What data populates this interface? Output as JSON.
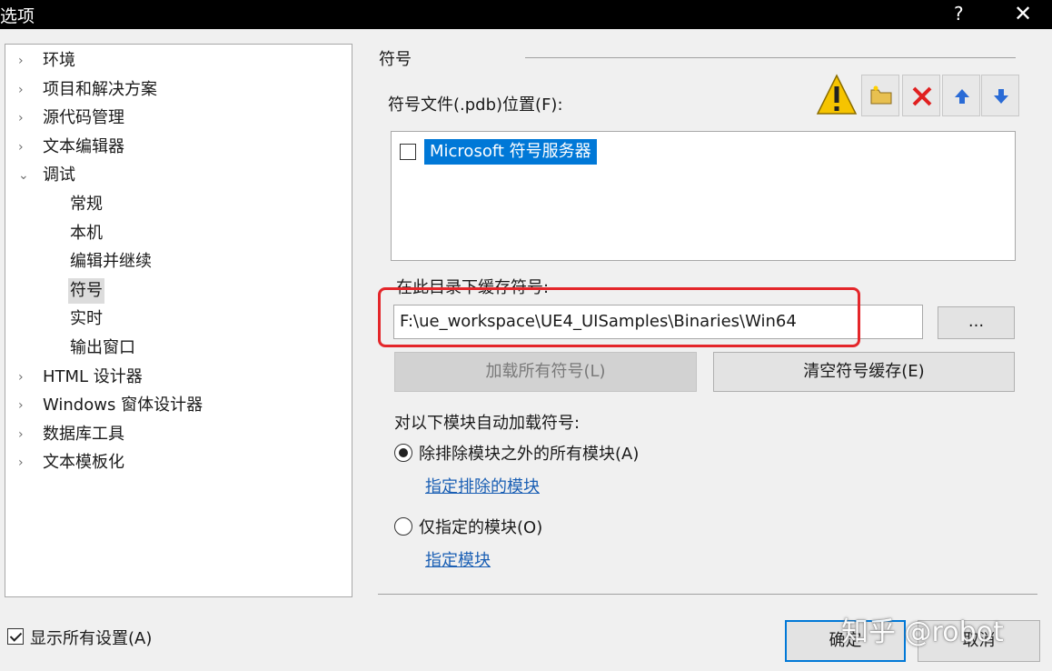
{
  "window": {
    "title": "选项",
    "help_label": "?",
    "close_label": "✕"
  },
  "tree": {
    "items": [
      {
        "label": "环境",
        "arrow": "›",
        "level": 0
      },
      {
        "label": "项目和解决方案",
        "arrow": "›",
        "level": 0
      },
      {
        "label": "源代码管理",
        "arrow": "›",
        "level": 0
      },
      {
        "label": "文本编辑器",
        "arrow": "›",
        "level": 0
      },
      {
        "label": "调试",
        "arrow": "⌄",
        "level": 0
      },
      {
        "label": "常规",
        "arrow": "",
        "level": 1
      },
      {
        "label": "本机",
        "arrow": "",
        "level": 1
      },
      {
        "label": "编辑并继续",
        "arrow": "",
        "level": 1
      },
      {
        "label": "符号",
        "arrow": "",
        "level": 1,
        "selected": true
      },
      {
        "label": "实时",
        "arrow": "",
        "level": 1
      },
      {
        "label": "输出窗口",
        "arrow": "",
        "level": 1
      },
      {
        "label": "HTML 设计器",
        "arrow": "›",
        "level": 0
      },
      {
        "label": "Windows 窗体设计器",
        "arrow": "›",
        "level": 0
      },
      {
        "label": "数据库工具",
        "arrow": "›",
        "level": 0
      },
      {
        "label": "文本模板化",
        "arrow": "›",
        "level": 0
      }
    ]
  },
  "show_all": {
    "label": "显示所有设置(A)",
    "checked": true
  },
  "symbols": {
    "section_title": "符号",
    "pdb_label": "符号文件(.pdb)位置(F):",
    "toolbar_icons": [
      "warning-icon",
      "folder-icon",
      "delete-icon",
      "move-up-icon",
      "move-down-icon"
    ],
    "pdb_locations": [
      {
        "label": "Microsoft 符号服务器",
        "checked": false
      }
    ],
    "cache_label": "在此目录下缓存符号:",
    "cache_path": "F:\\ue_workspace\\UE4_UISamples\\Binaries\\Win64",
    "browse_label": "...",
    "load_all_label": "加载所有符号(L)",
    "clear_cache_label": "清空符号缓存(E)",
    "auto_load_label": "对以下模块自动加载符号:",
    "option_all_except": "除排除模块之外的所有模块(A)",
    "link_exclude": "指定排除的模块",
    "option_only": "仅指定的模块(O)",
    "link_include": "指定模块"
  },
  "footer": {
    "ok_label": "确定",
    "cancel_label": "取消"
  },
  "watermark": "知乎 @robot",
  "colors": {
    "highlight": "#e4262a",
    "selection": "#0078d7",
    "link": "#1a5fb4"
  }
}
